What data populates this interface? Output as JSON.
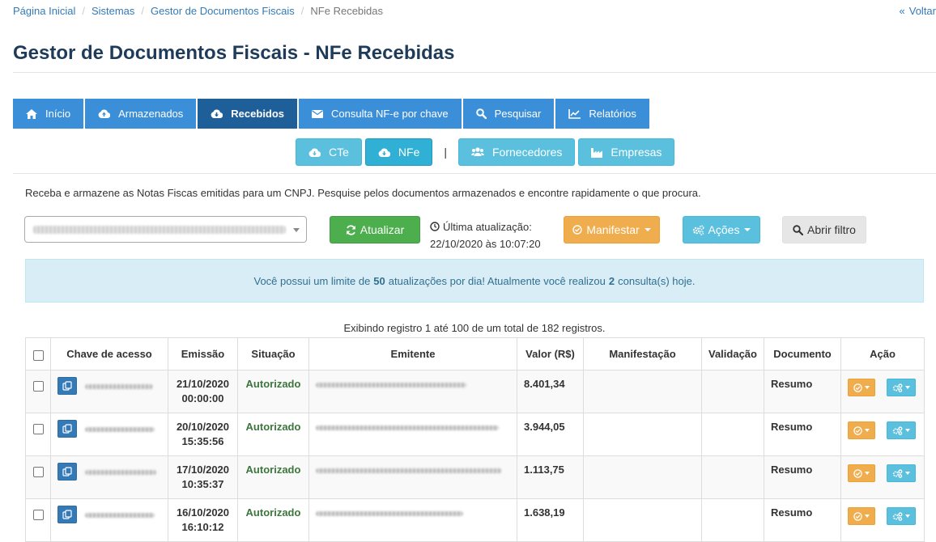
{
  "breadcrumb": {
    "items": [
      "Página Inicial",
      "Sistemas",
      "Gestor de Documentos Fiscais"
    ],
    "current": "NFe Recebidas",
    "back_label": "Voltar"
  },
  "page_title": "Gestor de Documentos Fiscais - NFe Recebidas",
  "main_tabs": [
    {
      "label": "Início",
      "icon": "home-icon"
    },
    {
      "label": "Armazenados",
      "icon": "cloud-upload-icon"
    },
    {
      "label": "Recebidos",
      "icon": "cloud-download-icon",
      "active": true
    },
    {
      "label": "Consulta NF-e por chave",
      "icon": "envelope-icon"
    },
    {
      "label": "Pesquisar",
      "icon": "search-icon"
    },
    {
      "label": "Relatórios",
      "icon": "line-chart-icon"
    }
  ],
  "sub_tabs": {
    "cte": "CTe",
    "nfe": "NFe",
    "separator": "|",
    "fornecedores": "Fornecedores",
    "empresas": "Empresas"
  },
  "intro_text": "Receba e armazene as Notas Fiscas emitidas para um CNPJ. Pesquise pelos documentos armazenados e encontre rapidamente o que procura.",
  "toolbar": {
    "update_label": "Atualizar",
    "last_update_label": "Última atualização:",
    "last_update_value": "22/10/2020 às 10:07:20",
    "manifest_label": "Manifestar",
    "actions_label": "Ações",
    "filter_label": "Abrir filtro"
  },
  "info": {
    "part1": "Você possui um limite de",
    "limit": "50",
    "part2": "atualizações por dia! Atualmente você realizou",
    "count": "2",
    "part3": "consulta(s) hoje."
  },
  "records_text": "Exibindo registro 1 até 100 de um total de 182 registros.",
  "table": {
    "headers": {
      "key": "Chave de acesso",
      "date": "Emissão",
      "status": "Situação",
      "issuer": "Emitente",
      "value": "Valor (R$)",
      "manifest": "Manifestação",
      "validation": "Validação",
      "document": "Documento",
      "action": "Ação"
    },
    "rows": [
      {
        "date": "21/10/2020",
        "time": "00:00:00",
        "status": "Autorizado",
        "value": "8.401,34",
        "document": "Resumo"
      },
      {
        "date": "20/10/2020",
        "time": "15:35:56",
        "status": "Autorizado",
        "value": "3.944,05",
        "document": "Resumo"
      },
      {
        "date": "17/10/2020",
        "time": "10:35:37",
        "status": "Autorizado",
        "value": "1.113,75",
        "document": "Resumo"
      },
      {
        "date": "16/10/2020",
        "time": "16:10:12",
        "status": "Autorizado",
        "value": "1.638,19",
        "document": "Resumo"
      }
    ]
  },
  "colors": {
    "primary": "#3b8fd9",
    "primary_active": "#1f5f99",
    "info": "#5bc0de",
    "success": "#4cae4c",
    "warning": "#f0ad4e",
    "title": "#1f3b5a"
  }
}
